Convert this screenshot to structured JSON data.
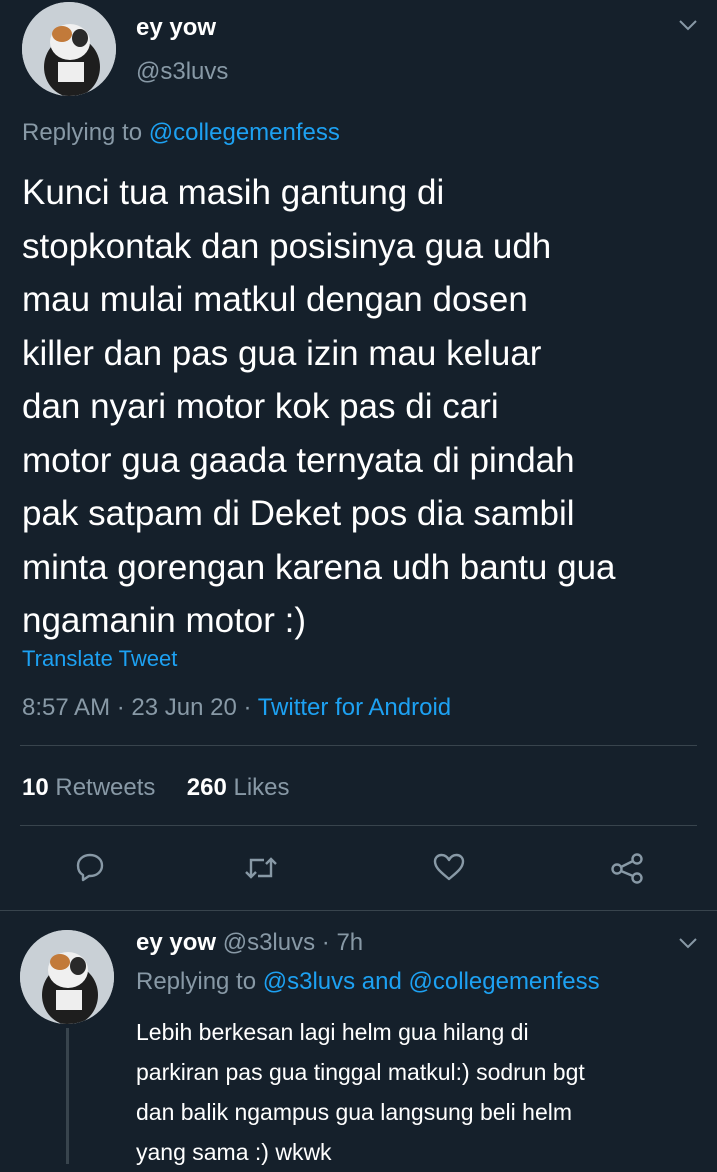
{
  "main_tweet": {
    "display_name": "ey yow",
    "handle": "@s3luvs",
    "replying_label": "Replying to",
    "replying_to": "@collegemenfess",
    "text_lines": [
      "Kunci tua masih gantung di",
      "stopkontak dan posisinya gua udh",
      "mau mulai matkul dengan dosen",
      "killer dan pas gua izin mau keluar",
      "dan nyari motor kok pas di cari",
      "motor gua gaada ternyata di pindah",
      "pak satpam di Deket pos dia sambil",
      "minta gorengan karena udh bantu gua",
      "ngamanin motor :)"
    ],
    "translate": "Translate Tweet",
    "time": "8:57 AM · 23 Jun 20 · ",
    "source": "Twitter for Android",
    "retweets_count": "10",
    "retweets_label": "Retweets",
    "likes_count": "260",
    "likes_label": "Likes"
  },
  "reply_tweet": {
    "display_name": "ey yow",
    "handle_time": "@s3luvs · 7h",
    "replying_label": "Replying to",
    "replying_to": "@s3luvs and @collegemenfess",
    "text_lines": [
      "Lebih berkesan lagi helm gua hilang di",
      "parkiran pas gua tinggal matkul:) sodrun bgt",
      "dan balik ngampus gua langsung beli helm",
      "yang sama :) wkwk"
    ]
  },
  "colors": {
    "background": "#15202b",
    "text": "#ffffff",
    "muted": "#8899a6",
    "accent": "#1da1f2",
    "divider": "#38444d"
  },
  "icons": [
    "chevron-down-icon",
    "reply-icon",
    "retweet-icon",
    "like-icon",
    "share-icon",
    "avatar"
  ]
}
